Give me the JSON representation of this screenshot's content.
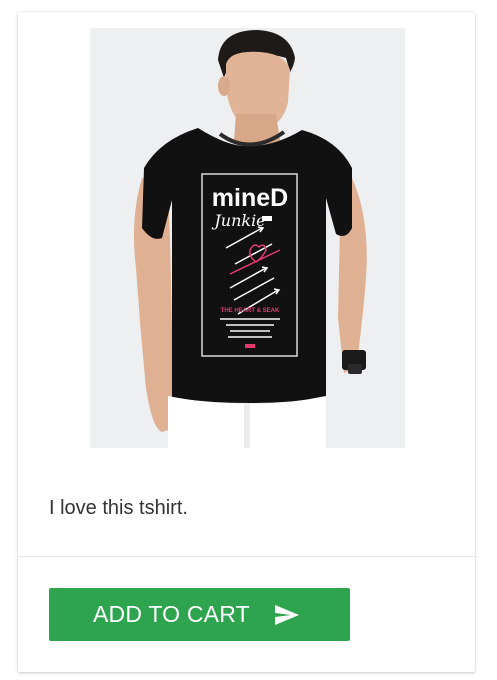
{
  "product": {
    "image_alt": "Black Mineed Junkie graphic t-shirt worn by model",
    "tshirt_brand_top": "mineD",
    "tshirt_brand_bottom": "Junkie",
    "tshirt_tagline": "THE HEART & SEAK",
    "description": "I love this tshirt."
  },
  "actions": {
    "add_to_cart_label": "ADD TO CART",
    "add_to_cart_icon": "send-icon"
  },
  "colors": {
    "button_bg": "#2ea44f",
    "button_text": "#ffffff",
    "image_bg": "#eeeff0",
    "text": "#333333"
  }
}
